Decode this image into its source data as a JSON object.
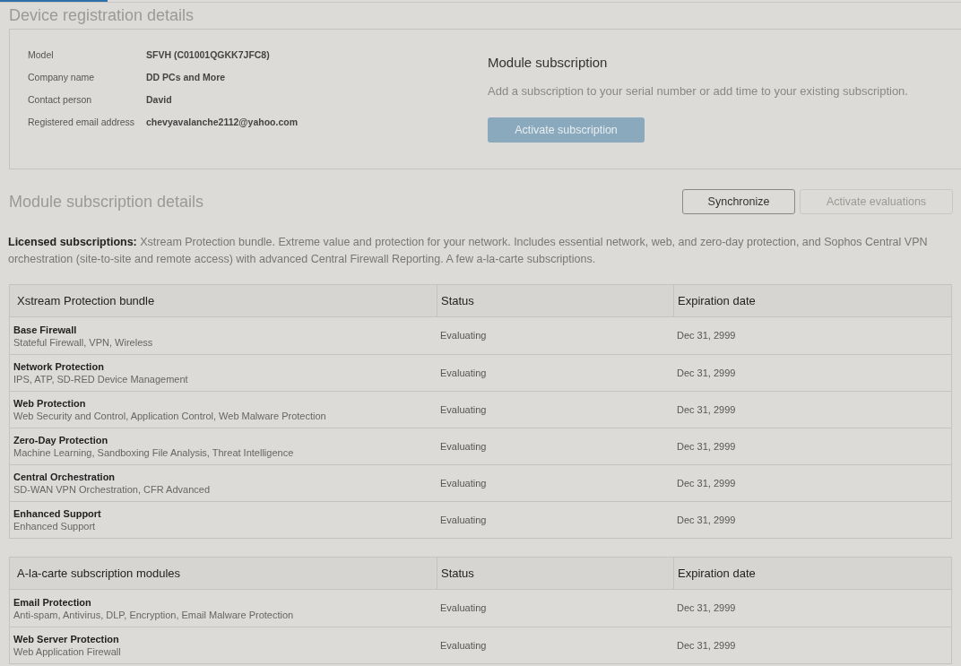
{
  "title": "Device registration details",
  "registration": {
    "fields": [
      {
        "label": "Model",
        "value": "SFVH (C01001QGKK7JFC8)"
      },
      {
        "label": "Company name",
        "value": "DD PCs and More"
      },
      {
        "label": "Contact person",
        "value": "David"
      },
      {
        "label": "Registered email address",
        "value": "chevyavalanche2112@yahoo.com"
      }
    ],
    "module": {
      "title": "Module subscription",
      "text": "Add a subscription to your serial number or add time to your existing subscription.",
      "button": {
        "label": "Activate subscription",
        "disabled": true
      }
    }
  },
  "details": {
    "title": "Module subscription details",
    "buttons": [
      {
        "label": "Synchronize",
        "disabled": false
      },
      {
        "label": "Activate evaluations",
        "disabled": true
      }
    ],
    "licensed_text": "**Licensed subscriptions:** Xstream Protection bundle. Extreme value and protection for your network. Includes essential network, web, and zero-day protection, and Sophos Central VPN orchestration (site-to-site and remote access) with advanced Central Firewall Reporting. A few a-la-carte subscriptions."
  },
  "tables": [
    {
      "columns": [
        "Xstream Protection bundle",
        "Status",
        "Expiration date"
      ],
      "rows": [
        {
          "name": "Base Firewall",
          "description": "Stateful Firewall, VPN, Wireless",
          "status": "Evaluating",
          "expiration": "Dec 31, 2999"
        },
        {
          "name": "Network Protection",
          "description": "IPS, ATP, SD-RED Device Management",
          "status": "Evaluating",
          "expiration": "Dec 31, 2999"
        },
        {
          "name": "Web Protection",
          "description": "Web Security and Control, Application Control, Web Malware Protection",
          "status": "Evaluating",
          "expiration": "Dec 31, 2999"
        },
        {
          "name": "Zero-Day Protection",
          "description": "Machine Learning, Sandboxing File Analysis, Threat Intelligence",
          "status": "Evaluating",
          "expiration": "Dec 31, 2999"
        },
        {
          "name": "Central Orchestration",
          "description": "SD-WAN VPN Orchestration, CFR Advanced",
          "status": "Evaluating",
          "expiration": "Dec 31, 2999"
        },
        {
          "name": "Enhanced Support",
          "description": "Enhanced Support",
          "status": "Evaluating",
          "expiration": "Dec 31, 2999"
        }
      ]
    },
    {
      "columns": [
        "A-la-carte subscription modules",
        "Status",
        "Expiration date"
      ],
      "rows": [
        {
          "name": "Email Protection",
          "description": "Anti-spam, Antivirus, DLP, Encryption, Email Malware Protection",
          "status": "Evaluating",
          "expiration": "Dec 31, 2999"
        },
        {
          "name": "Web Server Protection",
          "description": "Web Application Firewall",
          "status": "Evaluating",
          "expiration": "Dec 31, 2999"
        }
      ]
    }
  ]
}
